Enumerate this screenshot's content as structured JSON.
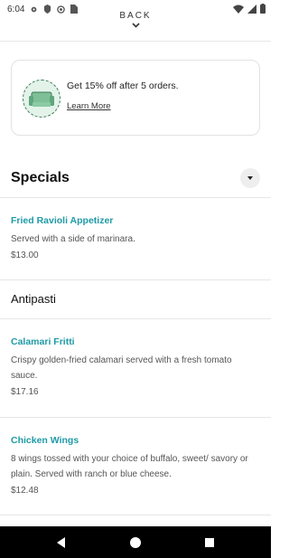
{
  "status": {
    "time": "6:04"
  },
  "header": {
    "back_label": "BACK"
  },
  "promo": {
    "text": "Get 15% off after 5 orders.",
    "link": "Learn More"
  },
  "specials": {
    "title": "Specials",
    "items": [
      {
        "name": "Fried Ravioli Appetizer",
        "description": "Served with a side of marinara.",
        "price": "$13.00"
      }
    ]
  },
  "antipasti": {
    "title": "Antipasti",
    "items": [
      {
        "name": "Calamari Fritti",
        "description": "Crispy golden-fried calamari served with a fresh tomato sauce.",
        "price": "$17.16"
      },
      {
        "name": "Chicken Wings",
        "description": "8 wings tossed with your choice of buffalo, sweet/ savory or plain.  Served with ranch or blue cheese.",
        "price": "$12.48"
      }
    ]
  }
}
